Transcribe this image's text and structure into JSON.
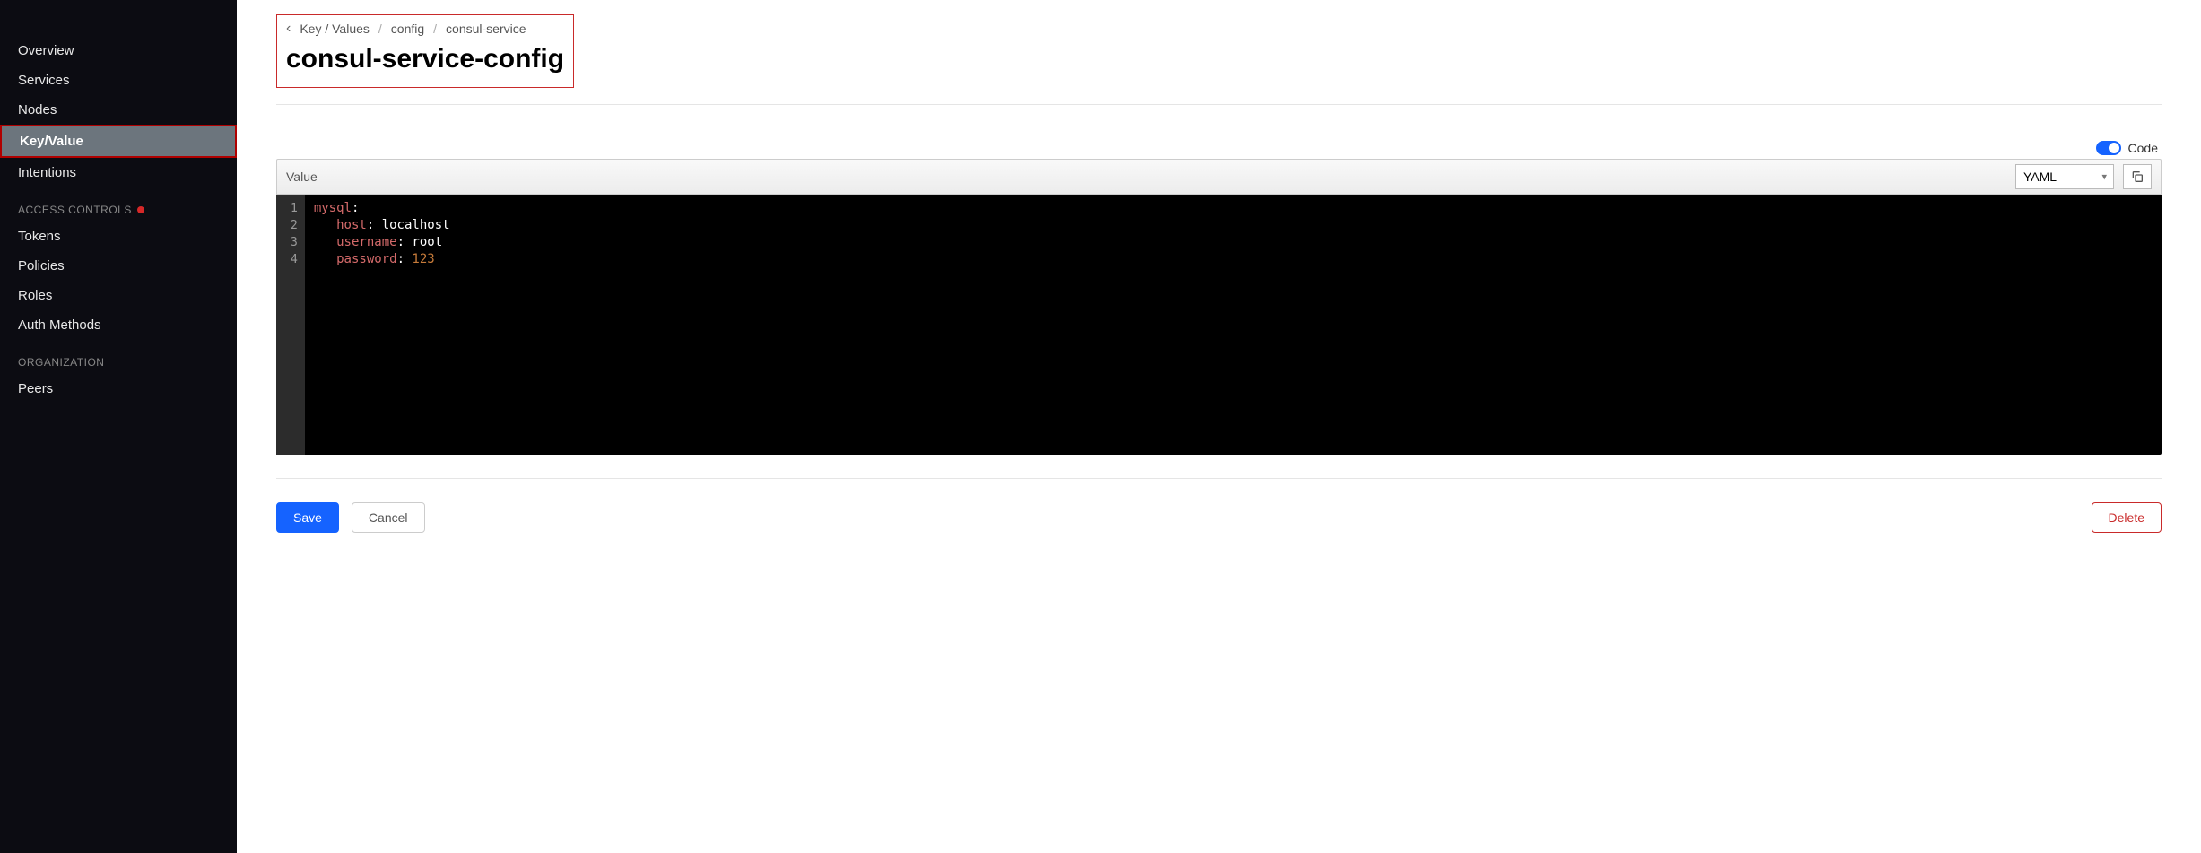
{
  "sidebar": {
    "main": [
      {
        "label": "Overview"
      },
      {
        "label": "Services"
      },
      {
        "label": "Nodes"
      },
      {
        "label": "Key/Value",
        "active": true
      },
      {
        "label": "Intentions"
      }
    ],
    "access_heading": "ACCESS CONTROLS",
    "access": [
      {
        "label": "Tokens"
      },
      {
        "label": "Policies"
      },
      {
        "label": "Roles"
      },
      {
        "label": "Auth Methods"
      }
    ],
    "org_heading": "ORGANIZATION",
    "org": [
      {
        "label": "Peers"
      }
    ]
  },
  "breadcrumb": {
    "root": "Key / Values",
    "parts": [
      "config",
      "consul-service"
    ]
  },
  "page_title": "consul-service-config",
  "code_toggle_label": "Code",
  "value_bar": {
    "label": "Value",
    "format": "YAML"
  },
  "editor_lines": [
    {
      "n": "1",
      "tokens": [
        {
          "t": "key",
          "v": "mysql"
        },
        {
          "t": "punct",
          "v": ":"
        }
      ]
    },
    {
      "n": "2",
      "tokens": [
        {
          "t": "indent",
          "v": "   "
        },
        {
          "t": "key",
          "v": "host"
        },
        {
          "t": "punct",
          "v": ": "
        },
        {
          "t": "str",
          "v": "localhost"
        }
      ]
    },
    {
      "n": "3",
      "tokens": [
        {
          "t": "indent",
          "v": "   "
        },
        {
          "t": "key",
          "v": "username"
        },
        {
          "t": "punct",
          "v": ": "
        },
        {
          "t": "str",
          "v": "root"
        }
      ]
    },
    {
      "n": "4",
      "tokens": [
        {
          "t": "indent",
          "v": "   "
        },
        {
          "t": "key",
          "v": "password"
        },
        {
          "t": "punct",
          "v": ": "
        },
        {
          "t": "num",
          "v": "123"
        }
      ]
    }
  ],
  "actions": {
    "save": "Save",
    "cancel": "Cancel",
    "delete": "Delete"
  }
}
